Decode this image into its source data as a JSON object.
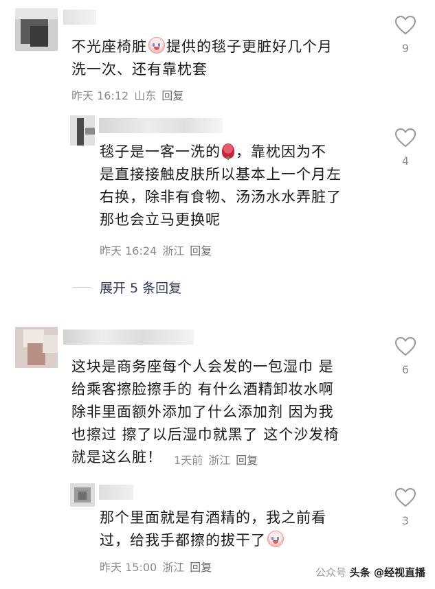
{
  "comments": [
    {
      "text_lines": [
        "不光座椅脏",
        "提供的毯子更脏好几个月",
        "洗一次、还有靠枕套"
      ],
      "time": "昨天 16:12",
      "location": "山东",
      "reply_label": "回复",
      "likes": "9",
      "reply": {
        "text_lines": [
          "毯子是一客一洗的",
          "，靠枕因为不",
          "是直接接触皮肤所以基本上一个月左",
          "右换，除非有食物、汤汤水水弄脏了",
          "那也会立马更换呢"
        ],
        "time": "昨天 16:24",
        "location": "浙江",
        "reply_label": "回复",
        "likes": "4"
      },
      "expand_label": "展开 5 条回复"
    },
    {
      "text_lines": [
        "这块是商务座每个人会发的一包湿巾 是",
        "给乘客擦脸擦手的 有什么酒精卸妆水啊",
        "除非里面额外添加了什么添加剂 因为我",
        "也擦过 擦了以后湿巾就黑了 这个沙发椅",
        "就是这么脏！"
      ],
      "time": "1天前",
      "location": "浙江",
      "reply_label": "回复",
      "likes": "6",
      "reply": {
        "text_lines": [
          "那个里面就是有酒精的，我之前看",
          "过，给我手都擦的拔干了"
        ],
        "time": "昨天 15:00",
        "location": "浙江",
        "reply_label": "回复",
        "likes": "3"
      }
    }
  ],
  "emojis": [
    "crying-face-emoji",
    "rose-emoji",
    "crying-face-emoji"
  ],
  "watermark": {
    "left": "公众号",
    "main": "头条 @经视直播"
  },
  "colors": {
    "text": "#1a1a1a",
    "meta": "#8a8b91",
    "expand": "#2f3a56",
    "heart": "#9b9ca1"
  }
}
